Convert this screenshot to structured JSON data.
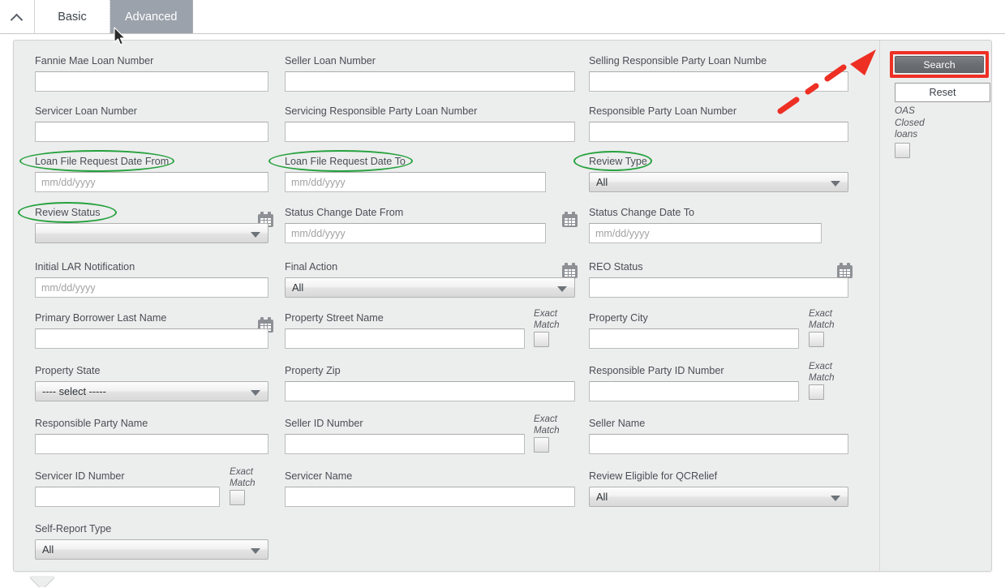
{
  "tabs": {
    "collapse_icon": "chevron-up-icon",
    "items": [
      {
        "label": "Basic",
        "active": false
      },
      {
        "label": "Advanced",
        "active": true
      }
    ]
  },
  "form": {
    "rows": [
      {
        "fields": [
          {
            "label": "Fannie Mae Loan Number",
            "type": "text",
            "value": ""
          },
          {
            "label": "Seller Loan Number",
            "type": "text",
            "value": ""
          },
          {
            "label": "Selling Responsible Party Loan Numbe",
            "type": "text",
            "value": ""
          }
        ]
      },
      {
        "fields": [
          {
            "label": "Servicer Loan Number",
            "type": "text",
            "value": ""
          },
          {
            "label": "Servicing Responsible Party Loan Number",
            "type": "text",
            "value": ""
          },
          {
            "label": "Responsible Party Loan Number",
            "type": "text",
            "value": ""
          }
        ]
      },
      {
        "fields": [
          {
            "label": "Loan File Request Date From",
            "type": "date",
            "placeholder": "mm/dd/yyyy",
            "value": "",
            "annotated": true
          },
          {
            "label": "Loan File Request Date To",
            "type": "date",
            "placeholder": "mm/dd/yyyy",
            "value": "",
            "annotated": true
          },
          {
            "label": "Review Type",
            "type": "select",
            "value": "All",
            "annotated": true
          }
        ]
      },
      {
        "fields": [
          {
            "label": "Review Status",
            "type": "select",
            "value": "",
            "annotated": true
          },
          {
            "label": "Status Change Date From",
            "type": "date",
            "placeholder": "mm/dd/yyyy",
            "value": ""
          },
          {
            "label": "Status Change Date To",
            "type": "date",
            "placeholder": "mm/dd/yyyy",
            "value": ""
          }
        ]
      },
      {
        "fields": [
          {
            "label": "Initial LAR Notification",
            "type": "date",
            "placeholder": "mm/dd/yyyy",
            "value": ""
          },
          {
            "label": "Final Action",
            "type": "select",
            "value": "All"
          },
          {
            "label": "REO Status",
            "type": "text",
            "value": ""
          }
        ]
      },
      {
        "fields": [
          {
            "label": "Primary Borrower Last Name",
            "type": "text",
            "value": ""
          },
          {
            "label": "Property Street Name",
            "type": "text",
            "value": "",
            "exact_match": true
          },
          {
            "label": "Property City",
            "type": "text",
            "value": "",
            "exact_match": true
          }
        ]
      },
      {
        "fields": [
          {
            "label": "Property State",
            "type": "select",
            "value": "---- select -----"
          },
          {
            "label": "Property Zip",
            "type": "text",
            "value": ""
          },
          {
            "label": "Responsible Party ID Number",
            "type": "text",
            "value": "",
            "exact_match": true
          }
        ]
      },
      {
        "fields": [
          {
            "label": "Responsible Party Name",
            "type": "text",
            "value": ""
          },
          {
            "label": "Seller ID Number",
            "type": "text",
            "value": "",
            "exact_match": true
          },
          {
            "label": "Seller Name",
            "type": "text",
            "value": ""
          }
        ]
      },
      {
        "fields": [
          {
            "label": "Servicer ID Number",
            "type": "text",
            "value": "",
            "exact_match": true
          },
          {
            "label": "Servicer Name",
            "type": "text",
            "value": ""
          },
          {
            "label": "Review Eligible for QCRelief",
            "type": "select",
            "value": "All"
          }
        ]
      },
      {
        "fields": [
          {
            "label": "Self-Report Type",
            "type": "select",
            "value": "All"
          }
        ]
      }
    ],
    "exact_match_label_line1": "Exact",
    "exact_match_label_line2": "Match",
    "date_placeholder": "mm/dd/yyyy",
    "calendar_icon": "calendar-icon"
  },
  "sidebar": {
    "search_label": "Search",
    "reset_label": "Reset",
    "oas_line1": "OAS",
    "oas_line2": "Closed",
    "oas_line3": "loans"
  },
  "annotations": {
    "highlight_color": "#ee2f24",
    "ellipse_color": "#24a13c",
    "arrow_color": "#ee2f24",
    "arrow_target": "search-button",
    "ellipse_targets": [
      "Loan File Request Date From",
      "Loan File Request Date To",
      "Review Type",
      "Review Status"
    ]
  },
  "colors": {
    "panel_bg": "#eceded",
    "active_tab_bg": "#9ba2ab",
    "search_btn_bg": "#6b6e73",
    "label_text": "#4a4f55"
  }
}
